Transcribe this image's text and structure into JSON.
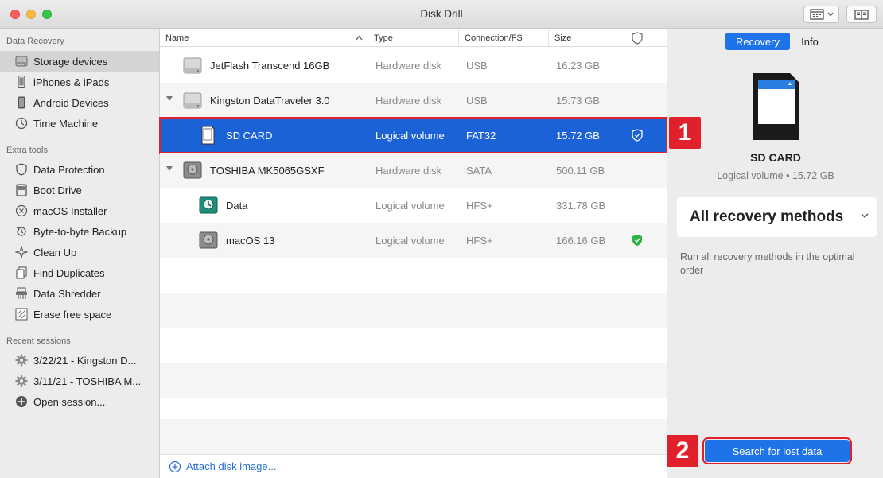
{
  "window": {
    "title": "Disk Drill"
  },
  "sidebar": {
    "sections": [
      {
        "label": "Data Recovery"
      },
      {
        "label": "Extra tools"
      },
      {
        "label": "Recent sessions"
      }
    ],
    "data_recovery": [
      {
        "label": "Storage devices",
        "icon": "hard-drive-icon",
        "active": true
      },
      {
        "label": "iPhones & iPads",
        "icon": "iphone-icon"
      },
      {
        "label": "Android Devices",
        "icon": "android-device-icon"
      },
      {
        "label": "Time Machine",
        "icon": "time-machine-icon"
      }
    ],
    "extra_tools": [
      {
        "label": "Data Protection",
        "icon": "shield-icon"
      },
      {
        "label": "Boot Drive",
        "icon": "boot-drive-icon"
      },
      {
        "label": "macOS Installer",
        "icon": "installer-icon"
      },
      {
        "label": "Byte-to-byte Backup",
        "icon": "backup-icon"
      },
      {
        "label": "Clean Up",
        "icon": "cleanup-icon"
      },
      {
        "label": "Find Duplicates",
        "icon": "duplicates-icon"
      },
      {
        "label": "Data Shredder",
        "icon": "shredder-icon"
      },
      {
        "label": "Erase free space",
        "icon": "erase-icon"
      }
    ],
    "recent_sessions": [
      {
        "label": "3/22/21 - Kingston D...",
        "icon": "gear-icon"
      },
      {
        "label": "3/11/21 - TOSHIBA M...",
        "icon": "gear-icon"
      },
      {
        "label": "Open session...",
        "icon": "plus-circle-icon"
      }
    ]
  },
  "table": {
    "columns": {
      "name": "Name",
      "type": "Type",
      "connection": "Connection/FS",
      "size": "Size"
    },
    "rows": [
      {
        "name": "JetFlash Transcend 16GB",
        "type": "Hardware disk",
        "connection": "USB",
        "size": "16.23 GB"
      },
      {
        "name": "Kingston DataTraveler 3.0",
        "type": "Hardware disk",
        "connection": "USB",
        "size": "15.73 GB"
      },
      {
        "name": "SD CARD",
        "type": "Logical volume",
        "connection": "FAT32",
        "size": "15.72 GB"
      },
      {
        "name": "TOSHIBA MK5065GSXF",
        "type": "Hardware disk",
        "connection": "SATA",
        "size": "500.11 GB"
      },
      {
        "name": "Data",
        "type": "Logical volume",
        "connection": "HFS+",
        "size": "331.78 GB"
      },
      {
        "name": "macOS 13",
        "type": "Logical volume",
        "connection": "HFS+",
        "size": "166.16 GB"
      }
    ],
    "attach_label": "Attach disk image..."
  },
  "right_panel": {
    "tabs": [
      "Recovery",
      "Info"
    ],
    "device_name": "SD CARD",
    "device_sub": "Logical volume • 15.72 GB",
    "method": "All recovery methods",
    "method_desc": "Run all recovery methods in the optimal order",
    "search_button": "Search for lost data"
  },
  "annotations": {
    "badge_1": "1",
    "badge_2": "2"
  },
  "colors": {
    "accent": "#1f73e8",
    "selection": "#1b62d6",
    "callout": "#e0202a",
    "protected_green": "#2fb344"
  }
}
